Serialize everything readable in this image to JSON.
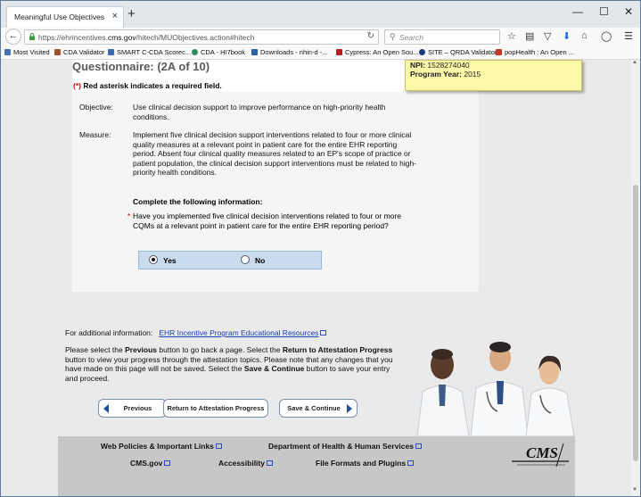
{
  "browser": {
    "tab_title": "Meaningful Use Objectives - E...",
    "tab_close": "×",
    "new_tab": "+",
    "url_prefix": "https://ehrincentives.",
    "url_domain": "cms.gov",
    "url_suffix": "/hitech/MUObjectives.action#hitech",
    "search_placeholder": "Search",
    "window_controls": {
      "minimize": "—",
      "maximize": "☐",
      "close": "✕"
    }
  },
  "bookmarks": [
    {
      "label": "Most Visited",
      "color": "#4a6fb5"
    },
    {
      "label": "CDA Validator",
      "color": "#a0522d"
    },
    {
      "label": "SMART C-CDA Scorec...",
      "color": "#3a6bb0"
    },
    {
      "label": "CDA - HI7book",
      "color": "#2e8b57"
    },
    {
      "label": "Downloads - nhin-d -...",
      "color": "#2b5fa8"
    },
    {
      "label": "Cypress: An Open Sou...",
      "color": "#b22222"
    },
    {
      "label": "SITE – QRDA Validator",
      "color": "#1d3d7a"
    },
    {
      "label": "popHealth : An Open ...",
      "color": "#c0392b"
    }
  ],
  "popup": {
    "npi_label": "NPI:",
    "npi_value": "1528274040",
    "year_label": "Program Year:",
    "year_value": "2015"
  },
  "questionnaire": {
    "title": "Questionnaire: (2A of 10)",
    "required_marker": "(*)",
    "required_text": "Red asterisk indicates a required field.",
    "objective_label": "Objective:",
    "objective_text": "Use clinical decision support to improve performance on high-priority health conditions.",
    "measure_label": "Measure:",
    "measure_text": "Implement five clinical decision support interventions related to four or more clinical quality measures at a relevant point in patient care for the entire EHR reporting period. Absent four clinical quality measures related to an EP's scope of practice or patient population, the clinical decision support interventions must be related to high-priority health conditions.",
    "complete_heading": "Complete the following information:",
    "question_asterisk": "*",
    "question_text": "Have you implemented five clinical decision interventions related to four or more CQMs at a relevant point in patient care for the entire EHR reporting period?",
    "options": [
      {
        "label": "Yes",
        "selected": true
      },
      {
        "label": "No",
        "selected": false
      }
    ]
  },
  "additional": {
    "prefix": "For additional information:",
    "link": "EHR Incentive Program Educational Resources"
  },
  "instructions": {
    "p1": "Please select the ",
    "b1": "Previous",
    "p2": " button to go back a page. Select the ",
    "b2": "Return to Attestation Progress",
    "p3": " button to view your progress through the attestation topics. Please note that any changes that you have made on this page will not be saved. Select the ",
    "b3": "Save & Continue",
    "p4": " button to save your entry and proceed."
  },
  "buttons": {
    "previous": "Previous",
    "return": "Return to Attestation Progress",
    "save": "Save & Continue"
  },
  "footer": {
    "web_policies": "Web Policies & Important Links",
    "dhhs": "Department of Health & Human Services",
    "cms_gov": "CMS.gov",
    "accessibility": "Accessibility",
    "file_formats": "File Formats and Plugins",
    "logo_text": "CMS"
  },
  "colors": {
    "accent_blue": "#1a3db8",
    "radio_row": "#c9dcef",
    "popup_bg": "#fbf8a8",
    "footer_bg": "#c7c7c7",
    "required_red": "#d00000"
  }
}
